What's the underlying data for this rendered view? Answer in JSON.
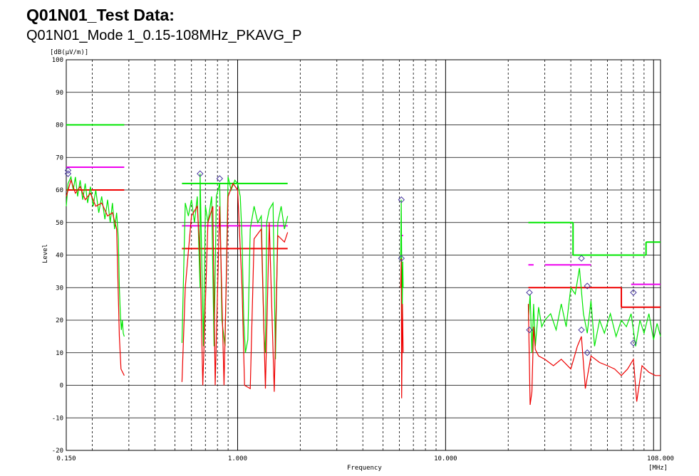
{
  "title": "Q01N01_Test Data:",
  "subtitle": "Q01N01_Mode 1_0.15-108MHz_PKAVG_P",
  "chart_data": {
    "type": "line",
    "x_scale": "log",
    "xlim": [
      0.15,
      108
    ],
    "ylim": [
      -20,
      100
    ],
    "ylabel": "Level",
    "yunit": "[dB(μV/m)]",
    "xlabel": "Frequency",
    "xunit": "[MHz]",
    "yticks": [
      "-20",
      "-10",
      "0",
      "10",
      "20",
      "30",
      "40",
      "50",
      "60",
      "70",
      "80",
      "90",
      "100"
    ],
    "xtick_labels": [
      {
        "x": 0.15,
        "label": "0.150"
      },
      {
        "x": 1,
        "label": "1.000"
      },
      {
        "x": 10,
        "label": "10.000"
      },
      {
        "x": 108,
        "label": "108.000"
      }
    ],
    "grid": true,
    "colors": {
      "peak": "#00e600",
      "average": "#ee0000",
      "peak_limit": "#00e600",
      "avg_limit": "#ee0000",
      "qp_limit": "#ee00ee",
      "marker": "#4a3aa0"
    },
    "limit_lines": [
      {
        "kind": "peak_limit",
        "segments": [
          [
            0.15,
            0.285,
            80
          ],
          [
            0.54,
            1.74,
            62
          ],
          [
            25,
            30,
            50
          ],
          [
            30,
            41,
            50
          ],
          [
            41,
            78,
            40
          ],
          [
            78,
            92,
            40
          ],
          [
            92,
            108,
            44
          ]
        ]
      },
      {
        "kind": "qp_limit",
        "segments": [
          [
            0.15,
            0.285,
            67
          ],
          [
            0.54,
            1.74,
            49
          ],
          [
            6.08,
            6.25,
            46
          ],
          [
            25,
            26.5,
            37
          ],
          [
            30,
            50,
            37
          ],
          [
            78,
            108,
            31
          ]
        ]
      },
      {
        "kind": "avg_limit",
        "segments": [
          [
            0.15,
            0.285,
            60
          ],
          [
            0.54,
            1.74,
            42
          ],
          [
            25,
            70,
            30
          ],
          [
            70,
            108,
            24
          ]
        ]
      }
    ],
    "series": [
      {
        "kind": "peak",
        "points": [
          [
            0.15,
            55
          ],
          [
            0.153,
            62
          ],
          [
            0.158,
            64
          ],
          [
            0.162,
            60
          ],
          [
            0.166,
            64
          ],
          [
            0.17,
            58
          ],
          [
            0.175,
            63
          ],
          [
            0.18,
            57
          ],
          [
            0.185,
            62
          ],
          [
            0.19,
            56
          ],
          [
            0.196,
            61
          ],
          [
            0.202,
            55
          ],
          [
            0.208,
            60
          ],
          [
            0.215,
            53
          ],
          [
            0.222,
            58
          ],
          [
            0.23,
            51
          ],
          [
            0.237,
            57
          ],
          [
            0.244,
            50
          ],
          [
            0.25,
            56
          ],
          [
            0.256,
            48
          ],
          [
            0.262,
            53
          ],
          [
            0.267,
            45
          ],
          [
            0.27,
            30
          ],
          [
            0.273,
            22
          ],
          [
            0.276,
            17
          ],
          [
            0.279,
            20
          ],
          [
            0.282,
            16
          ],
          [
            0.285,
            15
          ],
          [
            0.54,
            13
          ],
          [
            0.56,
            56
          ],
          [
            0.58,
            52
          ],
          [
            0.6,
            57
          ],
          [
            0.62,
            50
          ],
          [
            0.64,
            58
          ],
          [
            0.66,
            30
          ],
          [
            0.66,
            65
          ],
          [
            0.685,
            12
          ],
          [
            0.7,
            55
          ],
          [
            0.72,
            50
          ],
          [
            0.75,
            58
          ],
          [
            0.77,
            12
          ],
          [
            0.79,
            58
          ],
          [
            0.82,
            62
          ],
          [
            0.84,
            20
          ],
          [
            0.87,
            12
          ],
          [
            0.9,
            64
          ],
          [
            0.93,
            60
          ],
          [
            0.97,
            63
          ],
          [
            1.0,
            62
          ],
          [
            1.03,
            58
          ],
          [
            1.05,
            45
          ],
          [
            1.07,
            20
          ],
          [
            1.09,
            10
          ],
          [
            1.12,
            14
          ],
          [
            1.15,
            48
          ],
          [
            1.2,
            55
          ],
          [
            1.25,
            50
          ],
          [
            1.3,
            52
          ],
          [
            1.34,
            15
          ],
          [
            1.36,
            10
          ],
          [
            1.38,
            50
          ],
          [
            1.42,
            54
          ],
          [
            1.48,
            56
          ],
          [
            1.52,
            8
          ],
          [
            1.56,
            50
          ],
          [
            1.62,
            55
          ],
          [
            1.68,
            48
          ],
          [
            1.74,
            52
          ],
          [
            6.08,
            38
          ],
          [
            6.12,
            57
          ],
          [
            6.15,
            40
          ],
          [
            6.18,
            20
          ],
          [
            6.22,
            38
          ],
          [
            6.25,
            30
          ],
          [
            25,
            20
          ],
          [
            25.5,
            28
          ],
          [
            26,
            10
          ],
          [
            26.5,
            25
          ],
          [
            27,
            12
          ],
          [
            28,
            24
          ],
          [
            29,
            18
          ],
          [
            30,
            20
          ],
          [
            32,
            22
          ],
          [
            34,
            17
          ],
          [
            36,
            25
          ],
          [
            38,
            18
          ],
          [
            40,
            30
          ],
          [
            42,
            28
          ],
          [
            44,
            36
          ],
          [
            46,
            22
          ],
          [
            48,
            16
          ],
          [
            50,
            26
          ],
          [
            52,
            12
          ],
          [
            55,
            20
          ],
          [
            58,
            16
          ],
          [
            62,
            22
          ],
          [
            66,
            15
          ],
          [
            70,
            20
          ],
          [
            74,
            18
          ],
          [
            78,
            22
          ],
          [
            82,
            12
          ],
          [
            86,
            20
          ],
          [
            90,
            16
          ],
          [
            95,
            22
          ],
          [
            100,
            14
          ],
          [
            104,
            19
          ],
          [
            108,
            15
          ]
        ]
      },
      {
        "kind": "average",
        "points": [
          [
            0.15,
            58
          ],
          [
            0.158,
            63
          ],
          [
            0.166,
            59
          ],
          [
            0.175,
            61
          ],
          [
            0.185,
            57
          ],
          [
            0.196,
            59
          ],
          [
            0.208,
            55
          ],
          [
            0.222,
            56
          ],
          [
            0.237,
            52
          ],
          [
            0.25,
            53
          ],
          [
            0.262,
            48
          ],
          [
            0.27,
            15
          ],
          [
            0.275,
            5
          ],
          [
            0.285,
            3
          ],
          [
            0.54,
            1
          ],
          [
            0.56,
            30
          ],
          [
            0.6,
            52
          ],
          [
            0.64,
            55
          ],
          [
            0.66,
            40
          ],
          [
            0.68,
            0
          ],
          [
            0.72,
            50
          ],
          [
            0.76,
            55
          ],
          [
            0.78,
            0
          ],
          [
            0.82,
            55
          ],
          [
            0.86,
            0
          ],
          [
            0.9,
            58
          ],
          [
            0.95,
            62
          ],
          [
            1.0,
            60
          ],
          [
            1.05,
            30
          ],
          [
            1.08,
            0
          ],
          [
            1.15,
            -1
          ],
          [
            1.2,
            45
          ],
          [
            1.3,
            48
          ],
          [
            1.36,
            -1
          ],
          [
            1.42,
            50
          ],
          [
            1.5,
            -2
          ],
          [
            1.56,
            46
          ],
          [
            1.68,
            44
          ],
          [
            1.74,
            47
          ],
          [
            6.08,
            30
          ],
          [
            6.12,
            39
          ],
          [
            6.15,
            -4
          ],
          [
            6.2,
            25
          ],
          [
            6.25,
            10
          ],
          [
            25,
            25
          ],
          [
            25.5,
            -6
          ],
          [
            26,
            -2
          ],
          [
            26.5,
            18
          ],
          [
            27,
            11
          ],
          [
            28,
            9
          ],
          [
            30,
            8
          ],
          [
            33,
            6
          ],
          [
            36,
            8
          ],
          [
            40,
            5
          ],
          [
            43,
            12
          ],
          [
            45,
            15
          ],
          [
            47,
            -1
          ],
          [
            50,
            9
          ],
          [
            55,
            7
          ],
          [
            60,
            6
          ],
          [
            65,
            5
          ],
          [
            70,
            3
          ],
          [
            75,
            5
          ],
          [
            80,
            8
          ],
          [
            83,
            -5
          ],
          [
            88,
            6
          ],
          [
            95,
            4
          ],
          [
            102,
            3
          ],
          [
            108,
            3
          ]
        ]
      }
    ],
    "markers": [
      [
        0.153,
        65
      ],
      [
        0.153,
        66
      ],
      [
        0.66,
        65
      ],
      [
        0.82,
        63.5
      ],
      [
        6.13,
        39
      ],
      [
        6.13,
        57
      ],
      [
        25.3,
        17
      ],
      [
        25.3,
        28.5
      ],
      [
        45,
        17
      ],
      [
        45,
        39
      ],
      [
        48,
        30.5
      ],
      [
        48,
        10
      ],
      [
        80,
        13
      ],
      [
        80,
        28.5
      ]
    ]
  }
}
